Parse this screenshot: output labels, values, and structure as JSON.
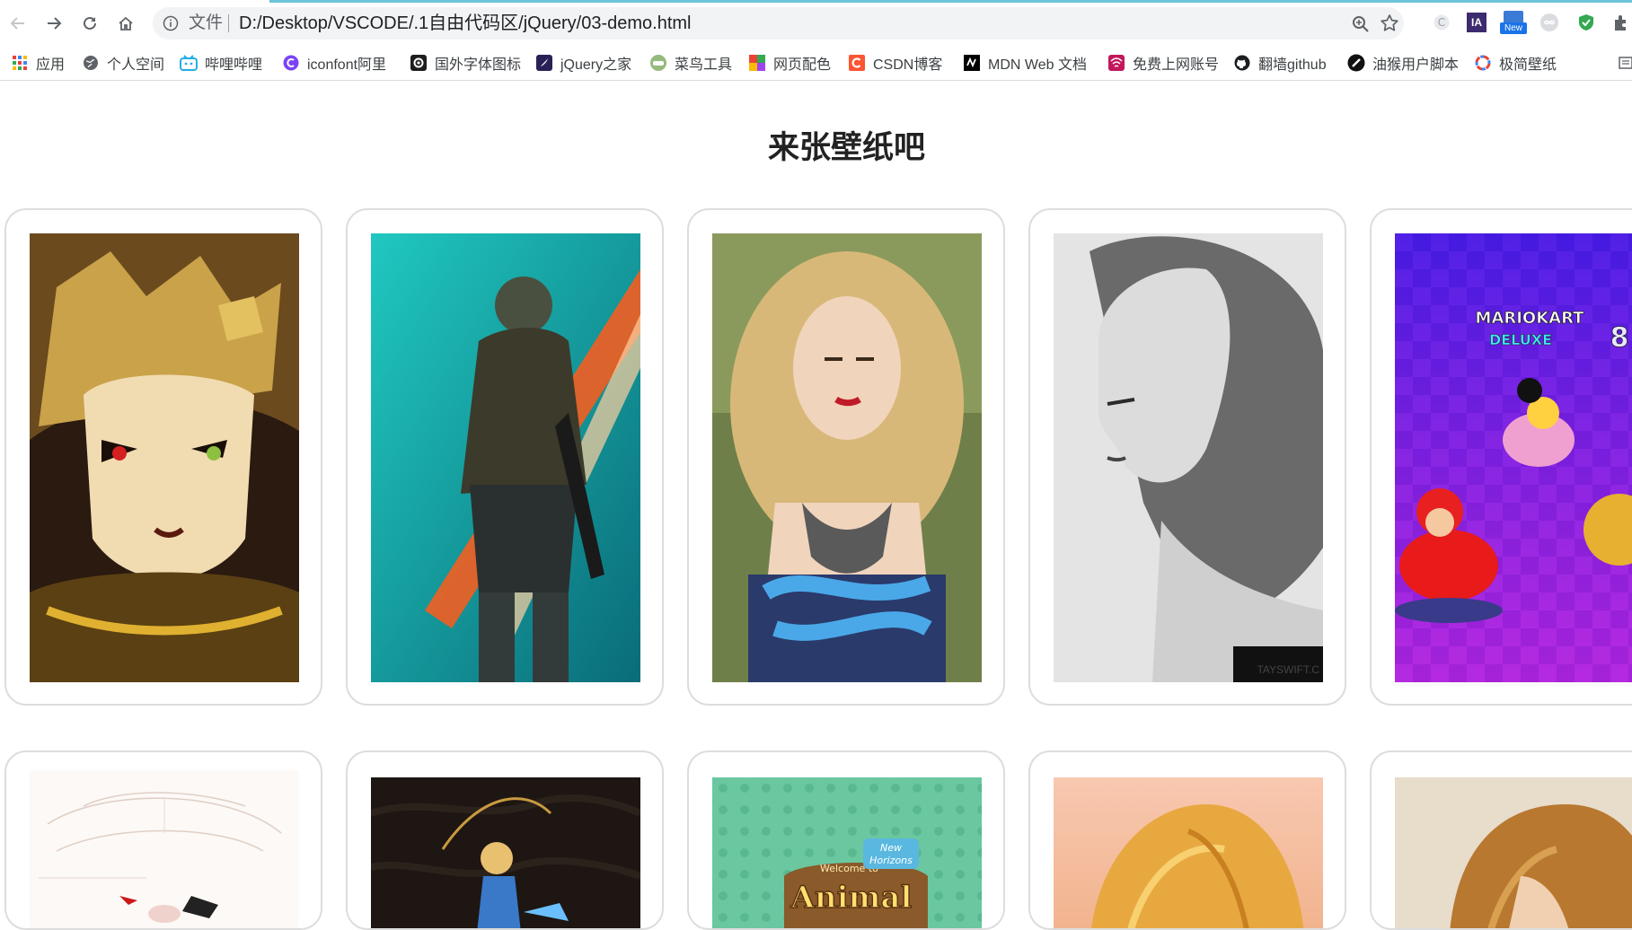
{
  "browser": {
    "omnibox": {
      "scheme_label": "文件",
      "url": "D:/Desktop/VSCODE/.1自由代码区/jQuery/03-demo.html"
    },
    "extensions": {
      "ia_label": "IA",
      "new_badge": "New"
    },
    "bookmarks": [
      {
        "label": "应用",
        "icon": "apps-grid-icon"
      },
      {
        "label": "个人空间",
        "icon": "globe-icon"
      },
      {
        "label": "哔哩哔哩",
        "icon": "bilibili-icon"
      },
      {
        "label": "iconfont阿里",
        "icon": "iconfont-icon"
      },
      {
        "label": "国外字体图标",
        "icon": "fontawesome-icon"
      },
      {
        "label": "jQuery之家",
        "icon": "jquery-icon"
      },
      {
        "label": "菜鸟工具",
        "icon": "runoob-icon"
      },
      {
        "label": "网页配色",
        "icon": "palette-icon"
      },
      {
        "label": "CSDN博客",
        "icon": "csdn-icon"
      },
      {
        "label": "MDN Web 文档",
        "icon": "mdn-icon"
      },
      {
        "label": "免费上网账号",
        "icon": "wifi-icon"
      },
      {
        "label": "翻墙github",
        "icon": "github-icon"
      },
      {
        "label": "油猴用户脚本",
        "icon": "tampermonkey-icon"
      },
      {
        "label": "极简壁纸",
        "icon": "wallpaper-icon"
      }
    ]
  },
  "page": {
    "title": "来张壁纸吧"
  },
  "wallpapers": {
    "watermark_tayswift": "TAYSWIFT.C",
    "mario_logo_top": "MARIOKART",
    "mario_logo_bottom": "DELUXE",
    "mario_logo_number": "8",
    "animal_welcome": "Welcome to",
    "animal_new": "New",
    "animal_horizons": "Horizons",
    "animal_title": "Animal"
  },
  "colors": {
    "accent_bar": "#6ec3dc",
    "card_border": "#dddddd"
  }
}
